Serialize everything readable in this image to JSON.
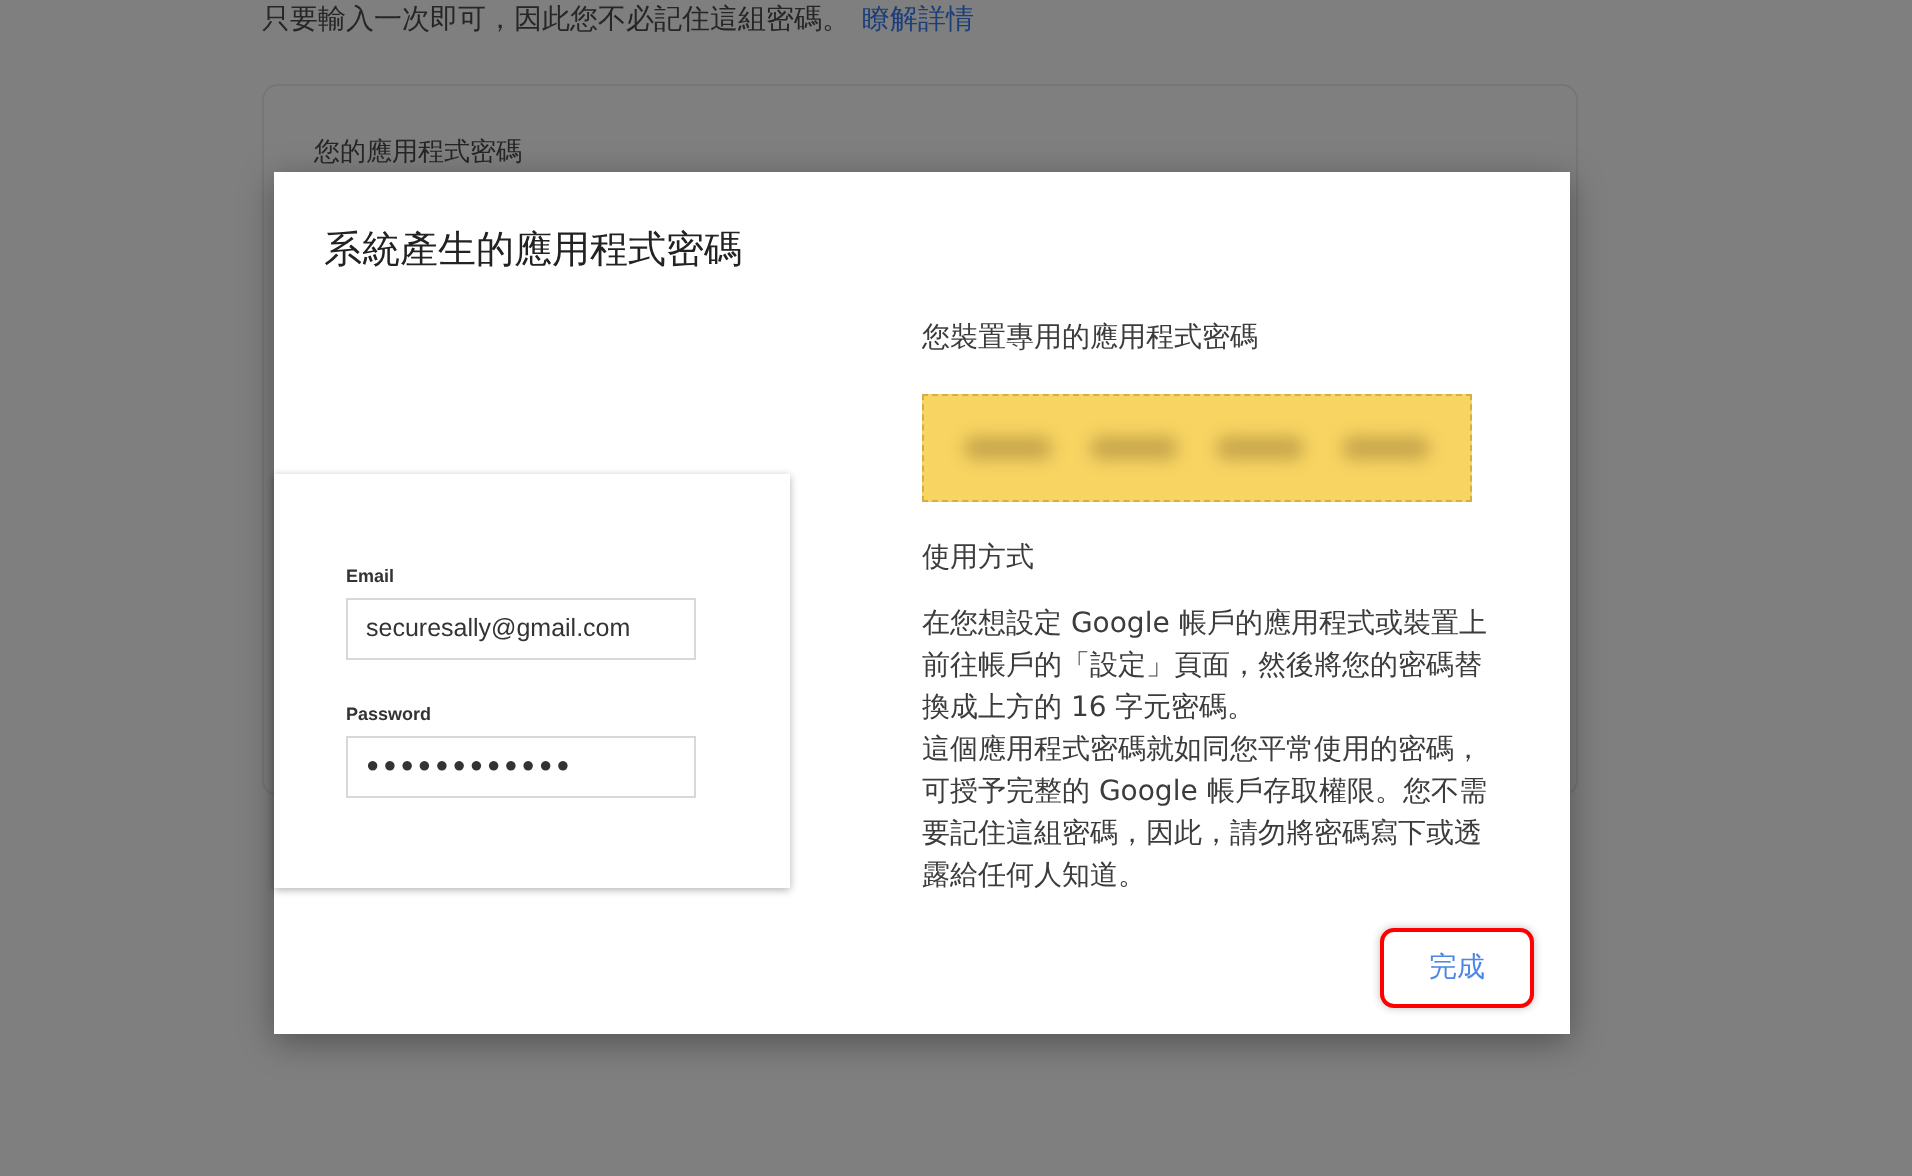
{
  "background_page": {
    "intro_text": "只要輸入一次即可，因此您不必記住這組密碼。",
    "learn_more_link": "瞭解詳情",
    "card_title": "您的應用程式密碼"
  },
  "dialog": {
    "title": "系統產生的應用程式密碼",
    "illustration": {
      "email_label": "Email",
      "email_value": "securesally@gmail.com",
      "password_label": "Password",
      "password_value": "●●●●●●●●●●●●"
    },
    "password_heading": "您裝置專用的應用程式密碼",
    "usage_heading": "使用方式",
    "usage_paragraphs": [
      "在您想設定 Google 帳戶的應用程式或裝置上前往帳戶的「設定」頁面，然後將您的密碼替換成上方的 16 字元密碼。",
      "這個應用程式密碼就如同您平常使用的密碼，可授予完整的 Google 帳戶存取權限。您不需要記住這組密碼，因此，請勿將密碼寫下或透露給任何人知道。"
    ],
    "done_button": {
      "label": "完成",
      "highlighted": true
    }
  }
}
